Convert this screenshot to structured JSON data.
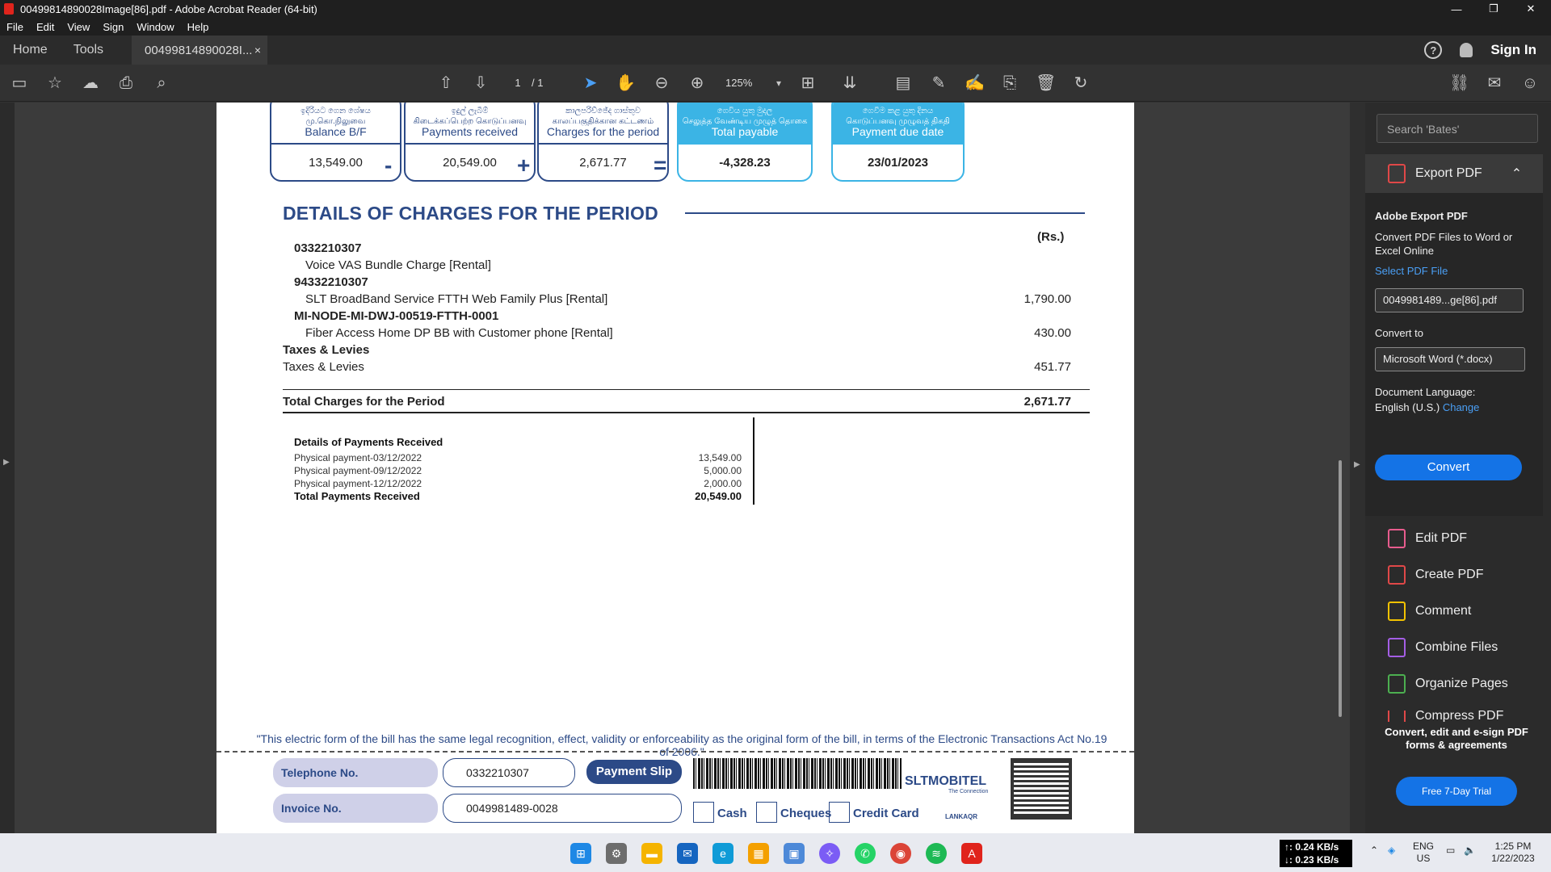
{
  "window": {
    "title": "00499814890028Image[86].pdf - Adobe Acrobat Reader (64-bit)",
    "min_glyph": "—",
    "restore_glyph": "❐",
    "close_glyph": "✕"
  },
  "menu": [
    "File",
    "Edit",
    "View",
    "Sign",
    "Window",
    "Help"
  ],
  "tabs": {
    "home": "Home",
    "tools": "Tools",
    "doc": "00499814890028I...",
    "close": "×",
    "help": "?",
    "signin": "Sign In"
  },
  "toolbar": {
    "page_current": "1",
    "page_total": "/ 1",
    "zoom": "125%"
  },
  "bill": {
    "summary": [
      {
        "si": "ඉදිරියට ගෙන ශේෂය",
        "ta": "மு.கொ.நிலுவை",
        "en": "Balance B/F",
        "value": "13,549.00"
      },
      {
        "si": "ඉදුල් ලැබීම්",
        "ta": "கிடைக்கப்பெற்ற கொடுப்பனவு",
        "en": "Payments received",
        "value": "20,549.00"
      },
      {
        "si": "කාලපරිච්ඡේද ගාස්තුව",
        "ta": "காலப்பகுதிக்கான கட்டணம்",
        "en": "Charges for the period",
        "value": "2,671.77"
      },
      {
        "si": "ගෙවිය යුතු මුදල",
        "ta": "செலுத்த வேண்டிய முழுத் தொகை",
        "en": "Total payable",
        "value": "-4,328.23"
      },
      {
        "si": "ගෙවීම කළ යුතු දිනය",
        "ta": "கொடுப்பனவு முழுவத் திகதி",
        "en": "Payment due date",
        "value": "23/01/2023"
      }
    ],
    "ops": [
      "-",
      "+",
      "="
    ],
    "section_title": "DETAILS OF CHARGES FOR THE PERIOD",
    "currency": "(Rs.)",
    "lines": [
      {
        "text": "0332210307",
        "bold": true,
        "amount": ""
      },
      {
        "text": "Voice VAS Bundle Charge [Rental]",
        "bold": false,
        "amount": ""
      },
      {
        "text": "94332210307",
        "bold": true,
        "amount": ""
      },
      {
        "text": "SLT BroadBand Service FTTH Web Family Plus [Rental]",
        "bold": false,
        "amount": "1,790.00"
      },
      {
        "text": "MI-NODE-MI-DWJ-00519-FTTH-0001",
        "bold": true,
        "amount": ""
      },
      {
        "text": "Fiber Access Home DP BB with Customer phone [Rental]",
        "bold": false,
        "amount": "430.00"
      },
      {
        "text": "Taxes & Levies",
        "bold": true,
        "amount": ""
      },
      {
        "text": "Taxes & Levies",
        "bold": false,
        "amount": "451.77"
      }
    ],
    "total_label": "Total Charges for the Period",
    "total_value": "2,671.77",
    "payments_title": "Details of Payments Received",
    "payments": [
      {
        "label": "Physical payment-03/12/2022",
        "amount": "13,549.00"
      },
      {
        "label": "Physical payment-09/12/2022",
        "amount": "5,000.00"
      },
      {
        "label": "Physical payment-12/12/2022",
        "amount": "2,000.00"
      }
    ],
    "payments_total_label": "Total Payments Received",
    "payments_total_value": "20,549.00",
    "legal_note": "\"This electric form of the bill has the same legal recognition, effect, validity or enforceability as the original form of the bill, in terms of the Electronic Transactions Act No.19 of 2006.\"",
    "slip": {
      "tel_label": "Telephone No.",
      "tel_value": "0332210307",
      "payslip": "Payment Slip",
      "invoice_label": "Invoice No.",
      "invoice_value": "0049981489-0028",
      "brand": "SLTMOBITEL",
      "brand_sub": "The Connection",
      "lankaqr": "LANKAQR",
      "cash": "Cash",
      "cheques": "Cheques",
      "credit": "Credit Card"
    }
  },
  "right_panel": {
    "search_placeholder": "Search 'Bates'",
    "export_pdf": "Export PDF",
    "adobe_export": "Adobe Export PDF",
    "convert_desc": "Convert PDF Files to Word or Excel Online",
    "select_file": "Select PDF File",
    "file_name": "0049981489...ge[86].pdf",
    "convert_to": "Convert to",
    "format": "Microsoft Word (*.docx)",
    "doc_lang_label": "Document Language:",
    "doc_lang": "English (U.S.)",
    "change": "Change",
    "convert_btn": "Convert",
    "tools": [
      "Edit PDF",
      "Create PDF",
      "Comment",
      "Combine Files",
      "Organize Pages",
      "Compress PDF"
    ],
    "promo": "Convert, edit and e-sign PDF forms & agreements",
    "trial": "Free 7-Day Trial"
  },
  "taskbar": {
    "net_up": "↑: 0.24 KB/s",
    "net_down": "↓: 0.23 KB/s",
    "lang1": "ENG",
    "lang2": "US",
    "time": "1:25 PM",
    "date": "1/22/2023"
  }
}
